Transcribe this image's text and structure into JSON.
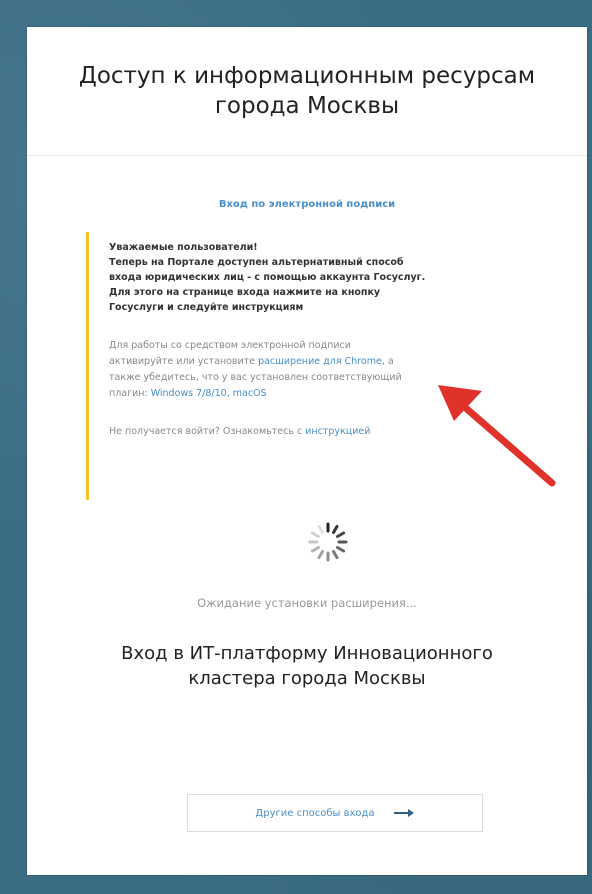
{
  "header": {
    "title_line1": "Доступ к информационным ресурсам",
    "title_line2": "города Москвы"
  },
  "eds_link": "Вход по электронной подписи",
  "notice": {
    "bold_lines": [
      "Уважаемые пользователи!",
      "Теперь на Портале доступен альтернативный способ",
      "входа юридических лиц - с помощью аккаунта Госуслуг.",
      "Для этого на странице входа нажмите на кнопку",
      "Госуслуги и следуйте инструкциям"
    ],
    "ext_line1": "Для работы со средством электронной подписи",
    "ext_line2_pre": "активируйте или установите ",
    "ext_link": "расширение для Chrome",
    "ext_line2_post": ", а",
    "ext_line3": "также убедитесь, что у вас установлен соответствующий",
    "ext_line4_pre": "плагин: ",
    "plugin_link": "Windows 7/8/10, macOS",
    "help_pre": "Не получается войти? Ознакомьтесь с ",
    "help_link": "инструкцией"
  },
  "status": {
    "waiting": "Ожидание установки расширения..."
  },
  "it_platform": {
    "line1": "Вход в ИТ-платформу Инновационного",
    "line2": "кластера города Москвы"
  },
  "other_login": {
    "label": "Другие способы входа",
    "icon": "arrow-right-icon"
  },
  "colors": {
    "background": "#3b6e85",
    "link": "#4a8fc8",
    "notice_border": "#f2c230",
    "annotation_arrow": "#e0312b"
  }
}
